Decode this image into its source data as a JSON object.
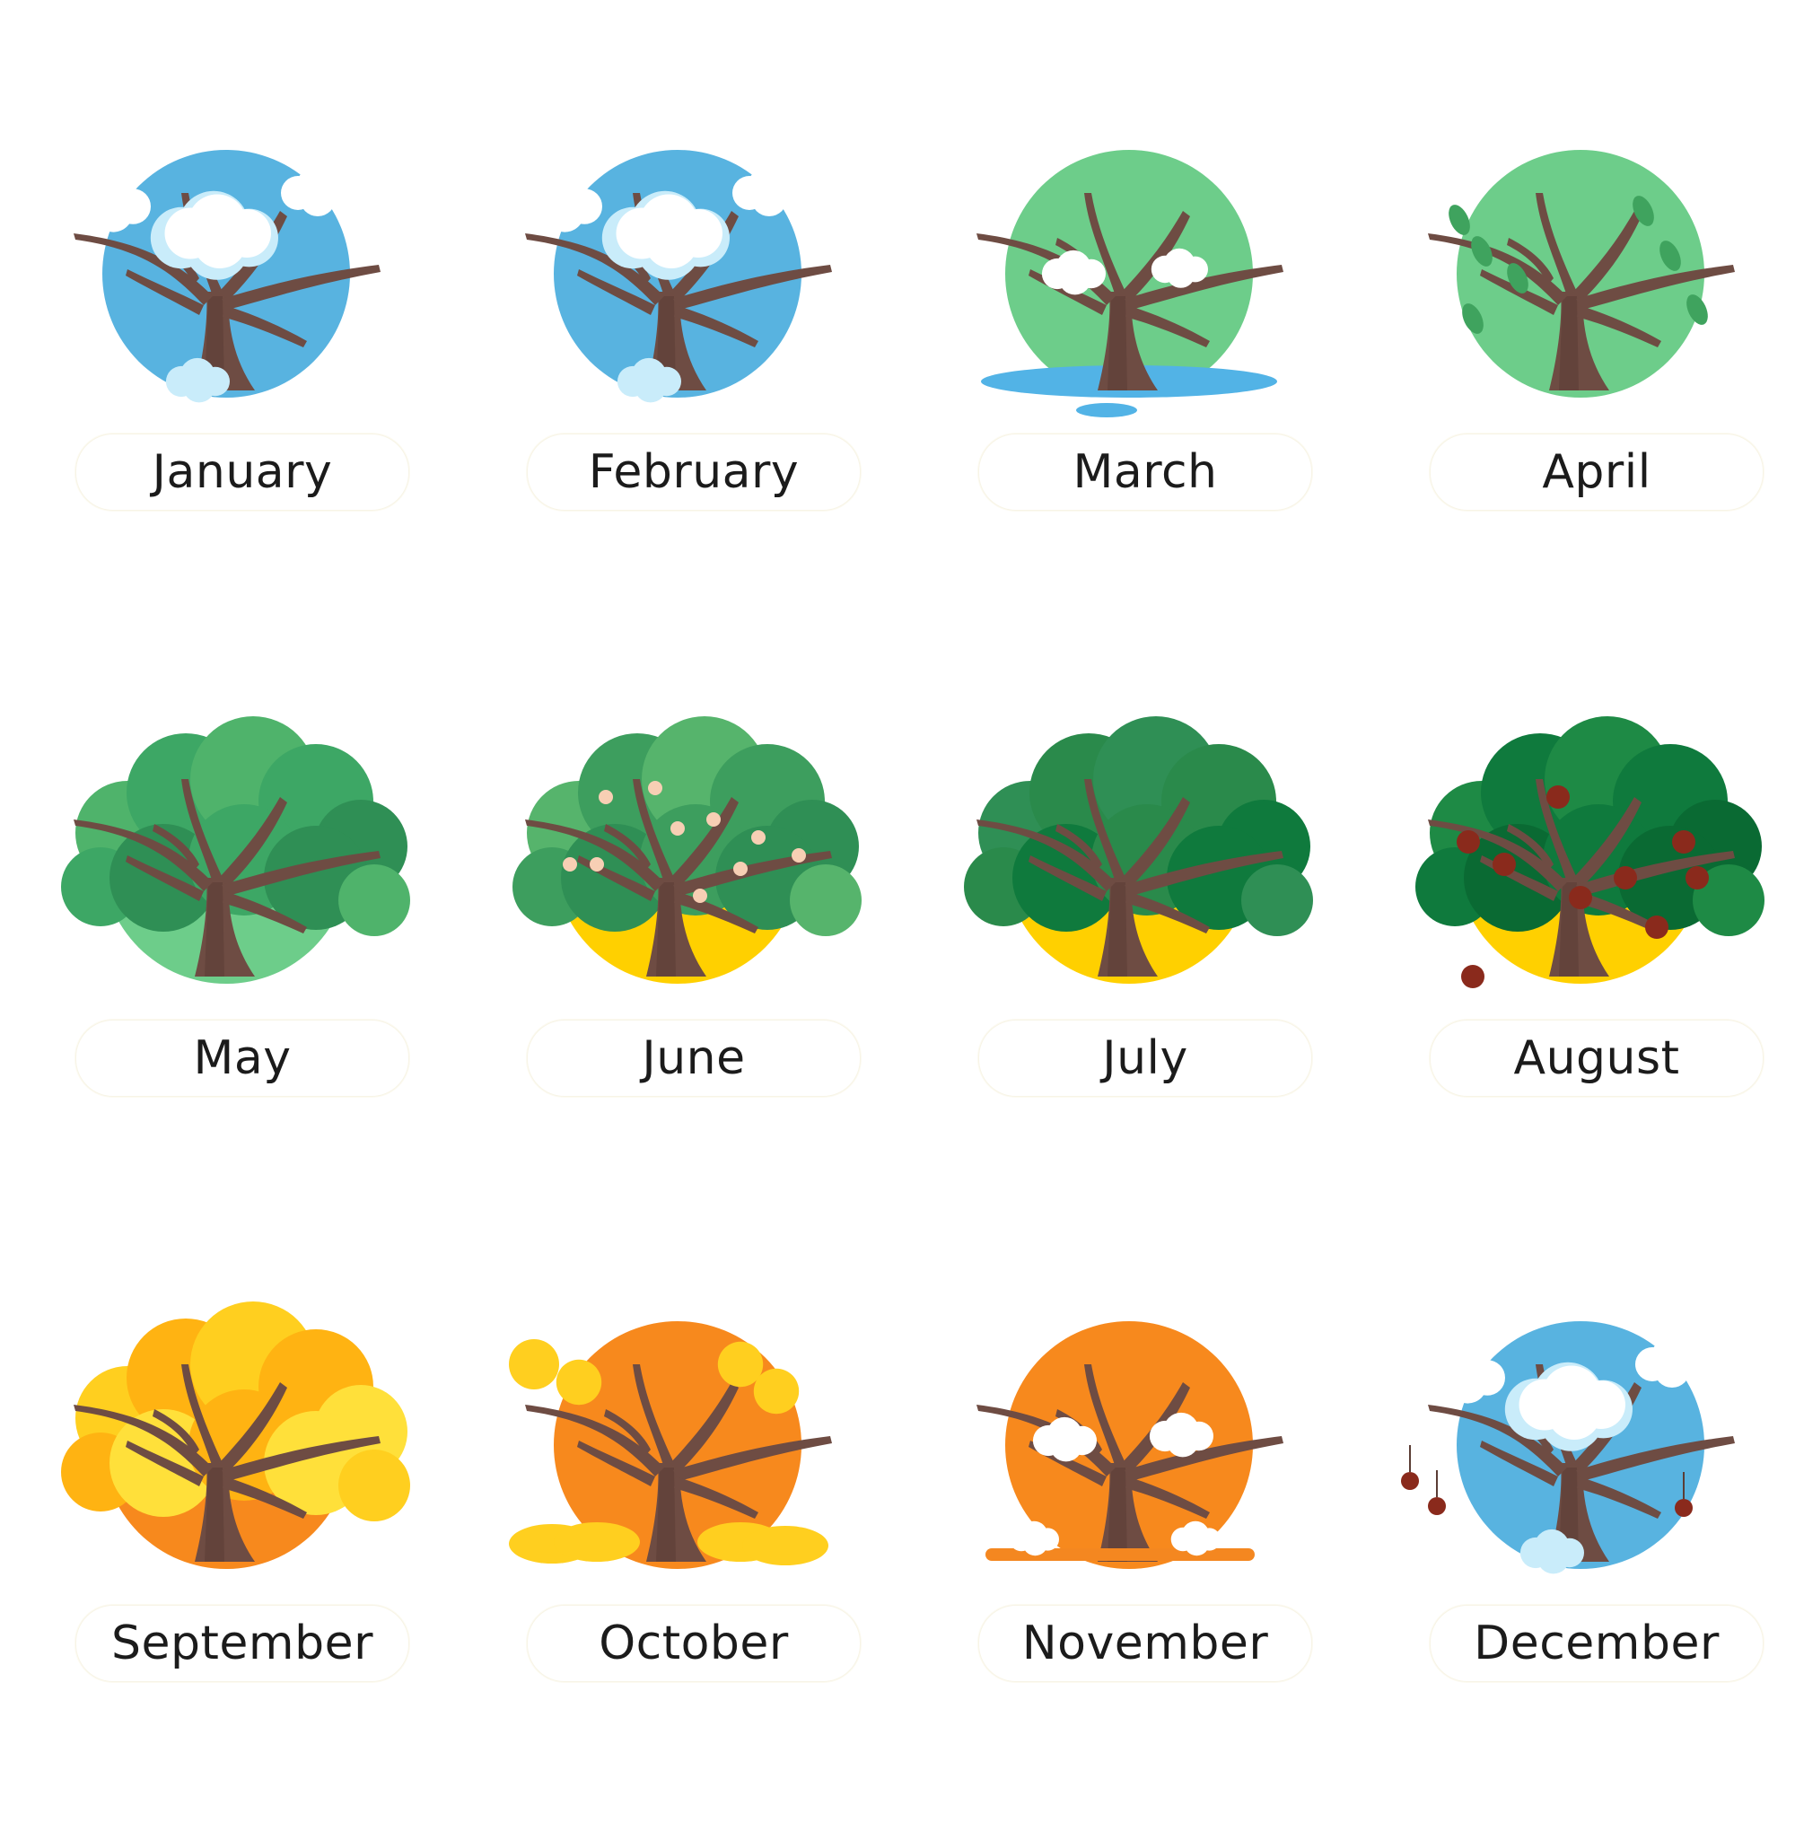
{
  "months": [
    {
      "label": "January",
      "theme": {
        "backdrop": "#58b3e0",
        "extra": "snow"
      }
    },
    {
      "label": "February",
      "theme": {
        "backdrop": "#58b3e0",
        "extra": "snow-light"
      }
    },
    {
      "label": "March",
      "theme": {
        "backdrop": "#6dcd8a",
        "extra": "melt"
      }
    },
    {
      "label": "April",
      "theme": {
        "backdrop": "#6dcd8a",
        "extra": "buds"
      }
    },
    {
      "label": "May",
      "theme": {
        "backdrop": "#6dcd8a",
        "extra": "leaves"
      }
    },
    {
      "label": "June",
      "theme": {
        "backdrop": "#ffd000",
        "extra": "blossoms"
      }
    },
    {
      "label": "July",
      "theme": {
        "backdrop": "#ffd000",
        "extra": "leaves-dark"
      }
    },
    {
      "label": "August",
      "theme": {
        "backdrop": "#ffd000",
        "extra": "fruit"
      }
    },
    {
      "label": "September",
      "theme": {
        "backdrop": "#f7891d",
        "extra": "yellow-leaves"
      }
    },
    {
      "label": "October",
      "theme": {
        "backdrop": "#f7891d",
        "extra": "falling-leaves"
      }
    },
    {
      "label": "November",
      "theme": {
        "backdrop": "#f7891d",
        "extra": "early-snow"
      }
    },
    {
      "label": "December",
      "theme": {
        "backdrop": "#58b3e0",
        "extra": "snow-fruit"
      }
    }
  ],
  "colors": {
    "trunk": "#6e4c43",
    "trunk_shade": "#5b3d35",
    "snow": "#ffffff",
    "snow_shade": "#c9ecfa",
    "leaf_light": "#4fb36b",
    "leaf_mid": "#2f8f55",
    "leaf_dark": "#0f7a3d",
    "yellow_leaf": "#ffcf1f",
    "orange_leaf": "#ffb312",
    "water": "#52b3e6",
    "fruit": "#8a2a1c",
    "blossom": "#f7cfb4"
  }
}
